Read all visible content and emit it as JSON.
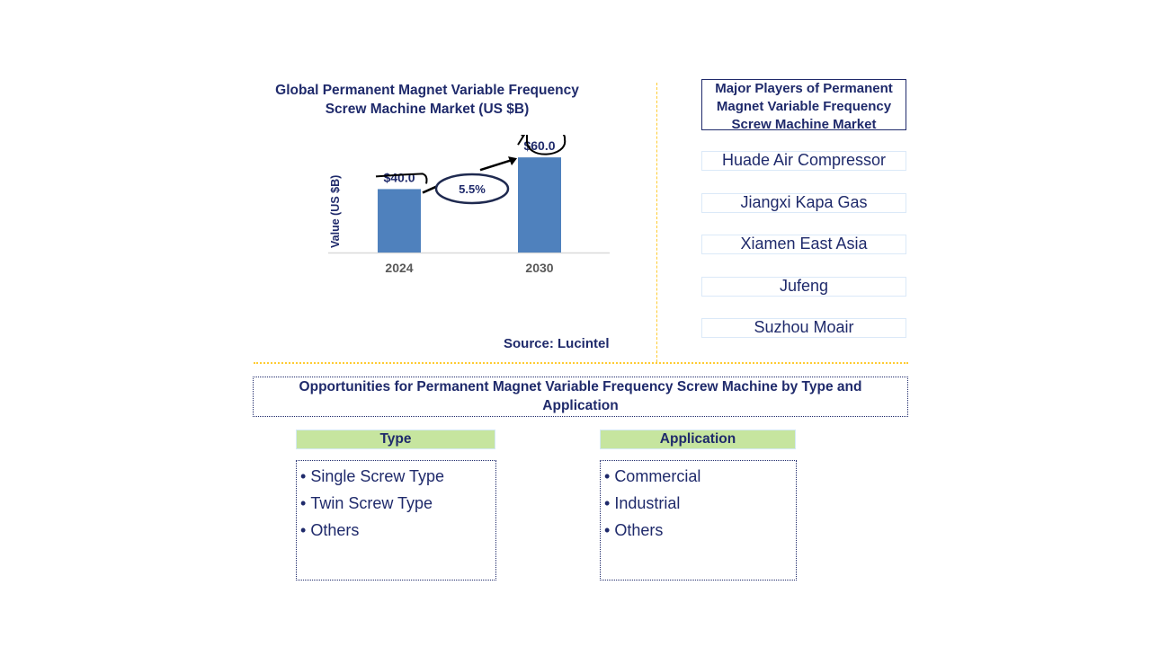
{
  "chart_data": {
    "type": "bar",
    "title": "Global Permanent Magnet Variable Frequency Screw Machine Market (US $B)",
    "title_lines": [
      "Global Permanent Magnet Variable Frequency",
      "Screw Machine Market (US $B)"
    ],
    "categories": [
      "2024",
      "2030"
    ],
    "values": [
      40.0,
      60.0
    ],
    "value_labels": [
      "$40.0",
      "$60.0"
    ],
    "xlabel": "",
    "ylabel": "Value (US $B)",
    "ylim": [
      0,
      70
    ],
    "grid": false,
    "bar_color": "#4f81bd",
    "annotation": {
      "type": "cagr",
      "text": "5.5%"
    }
  },
  "source": "Source: Lucintel",
  "players": {
    "title_lines": [
      "Major Players of Permanent",
      "Magnet Variable Frequency",
      "Screw Machine Market"
    ],
    "items": [
      "Huade Air Compressor",
      "Jiangxi Kapa Gas",
      "Xiamen East Asia",
      "Jufeng",
      "Suzhou Moair"
    ]
  },
  "opportunities": {
    "title_lines": [
      "Opportunities for Permanent Magnet Variable Frequency Screw Machine by Type and",
      "Application"
    ],
    "segments": [
      {
        "header": "Type",
        "items": [
          "Single Screw Type",
          "Twin Screw Type",
          "Others"
        ]
      },
      {
        "header": "Application",
        "items": [
          "Commercial",
          "Industrial",
          "Others"
        ]
      }
    ]
  },
  "colors": {
    "text": "#1f2a6b",
    "bar": "#4f81bd",
    "divider": "#ffcc33",
    "segment_header_bg": "#c6e59f"
  }
}
